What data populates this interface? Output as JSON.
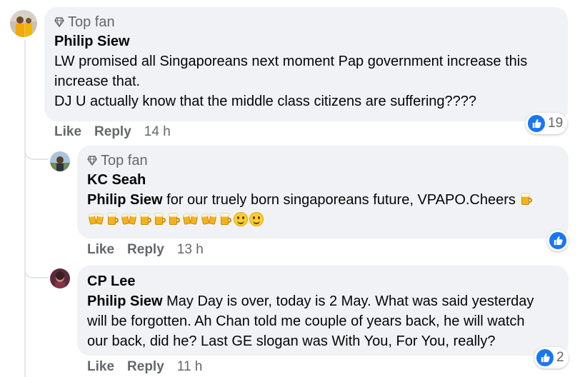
{
  "comments": [
    {
      "badge": "Top fan",
      "author": "Philip Siew",
      "lines": [
        "LW promised all Singaporeans next moment Pap government increase this",
        "increase that.",
        "DJ U actually know that the middle class citizens are suffering????"
      ],
      "actions": {
        "like": "Like",
        "reply": "Reply",
        "time": "14 h"
      },
      "reaction_count": "19"
    },
    {
      "badge": "Top fan",
      "author": "KC Seah",
      "mention": "Philip Siew",
      "text": " for our truely born singaporeans future, VPAPO.Cheers",
      "emoji_row": [
        "clink",
        "beer",
        "clink",
        "beer",
        "beer",
        "beer",
        "clink",
        "clink",
        "beer",
        "smile",
        "smile"
      ],
      "actions": {
        "like": "Like",
        "reply": "Reply",
        "time": "13 h"
      },
      "reaction_count": ""
    },
    {
      "author": "CP Lee",
      "mention": "Philip Siew",
      "line1": " May Day is over, today is 2 May. What was said yesterday",
      "line2": "will be forgotten. Ah Chan told me couple of years back, he will watch",
      "line3": "our back, did he? Last GE slogan was With You, For You, really?",
      "actions": {
        "like": "Like",
        "reply": "Reply",
        "time": "11 h"
      },
      "reaction_count": "2"
    }
  ],
  "colors": {
    "like_blue": "#1877f2",
    "bubble": "#f0f2f5",
    "meta": "#65676b"
  }
}
